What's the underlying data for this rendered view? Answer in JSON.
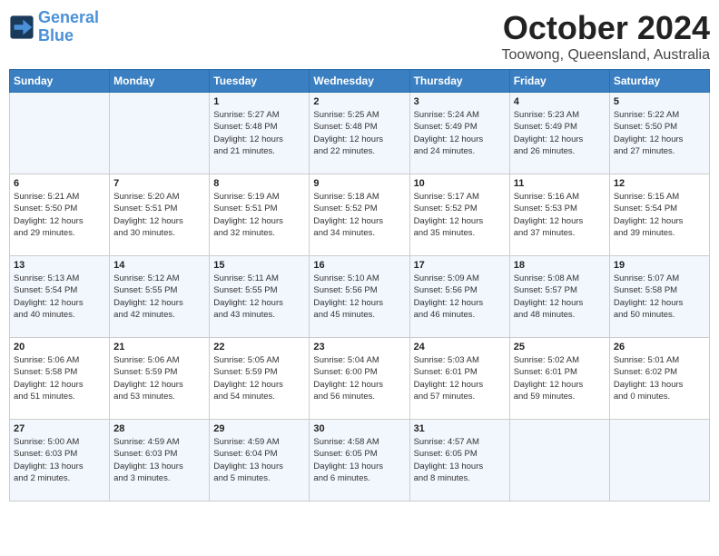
{
  "header": {
    "logo_line1": "General",
    "logo_line2": "Blue",
    "month": "October 2024",
    "location": "Toowong, Queensland, Australia"
  },
  "weekdays": [
    "Sunday",
    "Monday",
    "Tuesday",
    "Wednesday",
    "Thursday",
    "Friday",
    "Saturday"
  ],
  "weeks": [
    [
      {
        "day": "",
        "detail": ""
      },
      {
        "day": "",
        "detail": ""
      },
      {
        "day": "1",
        "detail": "Sunrise: 5:27 AM\nSunset: 5:48 PM\nDaylight: 12 hours\nand 21 minutes."
      },
      {
        "day": "2",
        "detail": "Sunrise: 5:25 AM\nSunset: 5:48 PM\nDaylight: 12 hours\nand 22 minutes."
      },
      {
        "day": "3",
        "detail": "Sunrise: 5:24 AM\nSunset: 5:49 PM\nDaylight: 12 hours\nand 24 minutes."
      },
      {
        "day": "4",
        "detail": "Sunrise: 5:23 AM\nSunset: 5:49 PM\nDaylight: 12 hours\nand 26 minutes."
      },
      {
        "day": "5",
        "detail": "Sunrise: 5:22 AM\nSunset: 5:50 PM\nDaylight: 12 hours\nand 27 minutes."
      }
    ],
    [
      {
        "day": "6",
        "detail": "Sunrise: 5:21 AM\nSunset: 5:50 PM\nDaylight: 12 hours\nand 29 minutes."
      },
      {
        "day": "7",
        "detail": "Sunrise: 5:20 AM\nSunset: 5:51 PM\nDaylight: 12 hours\nand 30 minutes."
      },
      {
        "day": "8",
        "detail": "Sunrise: 5:19 AM\nSunset: 5:51 PM\nDaylight: 12 hours\nand 32 minutes."
      },
      {
        "day": "9",
        "detail": "Sunrise: 5:18 AM\nSunset: 5:52 PM\nDaylight: 12 hours\nand 34 minutes."
      },
      {
        "day": "10",
        "detail": "Sunrise: 5:17 AM\nSunset: 5:52 PM\nDaylight: 12 hours\nand 35 minutes."
      },
      {
        "day": "11",
        "detail": "Sunrise: 5:16 AM\nSunset: 5:53 PM\nDaylight: 12 hours\nand 37 minutes."
      },
      {
        "day": "12",
        "detail": "Sunrise: 5:15 AM\nSunset: 5:54 PM\nDaylight: 12 hours\nand 39 minutes."
      }
    ],
    [
      {
        "day": "13",
        "detail": "Sunrise: 5:13 AM\nSunset: 5:54 PM\nDaylight: 12 hours\nand 40 minutes."
      },
      {
        "day": "14",
        "detail": "Sunrise: 5:12 AM\nSunset: 5:55 PM\nDaylight: 12 hours\nand 42 minutes."
      },
      {
        "day": "15",
        "detail": "Sunrise: 5:11 AM\nSunset: 5:55 PM\nDaylight: 12 hours\nand 43 minutes."
      },
      {
        "day": "16",
        "detail": "Sunrise: 5:10 AM\nSunset: 5:56 PM\nDaylight: 12 hours\nand 45 minutes."
      },
      {
        "day": "17",
        "detail": "Sunrise: 5:09 AM\nSunset: 5:56 PM\nDaylight: 12 hours\nand 46 minutes."
      },
      {
        "day": "18",
        "detail": "Sunrise: 5:08 AM\nSunset: 5:57 PM\nDaylight: 12 hours\nand 48 minutes."
      },
      {
        "day": "19",
        "detail": "Sunrise: 5:07 AM\nSunset: 5:58 PM\nDaylight: 12 hours\nand 50 minutes."
      }
    ],
    [
      {
        "day": "20",
        "detail": "Sunrise: 5:06 AM\nSunset: 5:58 PM\nDaylight: 12 hours\nand 51 minutes."
      },
      {
        "day": "21",
        "detail": "Sunrise: 5:06 AM\nSunset: 5:59 PM\nDaylight: 12 hours\nand 53 minutes."
      },
      {
        "day": "22",
        "detail": "Sunrise: 5:05 AM\nSunset: 5:59 PM\nDaylight: 12 hours\nand 54 minutes."
      },
      {
        "day": "23",
        "detail": "Sunrise: 5:04 AM\nSunset: 6:00 PM\nDaylight: 12 hours\nand 56 minutes."
      },
      {
        "day": "24",
        "detail": "Sunrise: 5:03 AM\nSunset: 6:01 PM\nDaylight: 12 hours\nand 57 minutes."
      },
      {
        "day": "25",
        "detail": "Sunrise: 5:02 AM\nSunset: 6:01 PM\nDaylight: 12 hours\nand 59 minutes."
      },
      {
        "day": "26",
        "detail": "Sunrise: 5:01 AM\nSunset: 6:02 PM\nDaylight: 13 hours\nand 0 minutes."
      }
    ],
    [
      {
        "day": "27",
        "detail": "Sunrise: 5:00 AM\nSunset: 6:03 PM\nDaylight: 13 hours\nand 2 minutes."
      },
      {
        "day": "28",
        "detail": "Sunrise: 4:59 AM\nSunset: 6:03 PM\nDaylight: 13 hours\nand 3 minutes."
      },
      {
        "day": "29",
        "detail": "Sunrise: 4:59 AM\nSunset: 6:04 PM\nDaylight: 13 hours\nand 5 minutes."
      },
      {
        "day": "30",
        "detail": "Sunrise: 4:58 AM\nSunset: 6:05 PM\nDaylight: 13 hours\nand 6 minutes."
      },
      {
        "day": "31",
        "detail": "Sunrise: 4:57 AM\nSunset: 6:05 PM\nDaylight: 13 hours\nand 8 minutes."
      },
      {
        "day": "",
        "detail": ""
      },
      {
        "day": "",
        "detail": ""
      }
    ]
  ]
}
